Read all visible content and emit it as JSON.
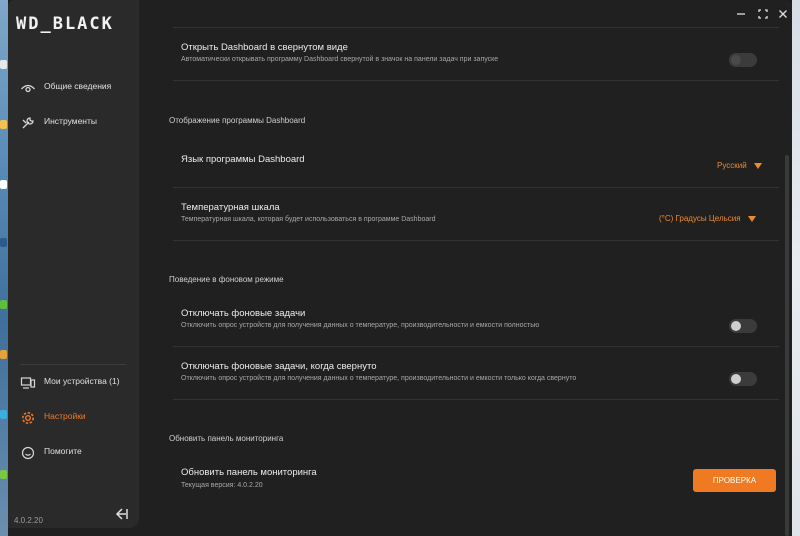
{
  "app": {
    "logo": "WD_BLACK",
    "version": "4.0.2.20"
  },
  "sidebar": {
    "items": [
      {
        "label": "Общие сведения",
        "icon": "eye-icon"
      },
      {
        "label": "Инструменты",
        "icon": "tools-icon"
      }
    ],
    "bottom_items": [
      {
        "label": "Мои устройства (1)",
        "icon": "devices-icon"
      },
      {
        "label": "Настройки",
        "icon": "gear-icon",
        "active": true
      },
      {
        "label": "Помогите",
        "icon": "help-icon"
      }
    ]
  },
  "settings": {
    "minimized": {
      "title": "Открыть Dashboard в свернутом виде",
      "desc": "Автоматически открывать программу Dashboard свернутой в значок на панели задач при запуске"
    },
    "display_section": "Отображение программы Dashboard",
    "language": {
      "title": "Язык программы Dashboard",
      "value": "Русский"
    },
    "temperature": {
      "title": "Температурная шкала",
      "desc": "Температурная шкала, которая будет использоваться в программе Dashboard",
      "value": "(°C) Градусы Цельсия"
    },
    "background_section": "Поведение в фоновом режиме",
    "bg_tasks": {
      "title": "Отключать фоновые задачи",
      "desc": "Отключить опрос устройств для получения данных о температуре, производительности и емкости полностью"
    },
    "bg_tasks_min": {
      "title": "Отключать фоновые задачи, когда свернуто",
      "desc": "Отключить опрос устройств для получения данных о температуре, производительности и емкости только когда свернуто"
    },
    "update_section": "Обновить панель мониторинга",
    "update": {
      "title": "Обновить панель мониторинга",
      "current": "Текущая версия: 4.0.2.20",
      "button": "ПРОВЕРКА"
    }
  },
  "colors": {
    "accent": "#f07a22",
    "background": "#202020",
    "sidebar": "#2a2a2a"
  }
}
